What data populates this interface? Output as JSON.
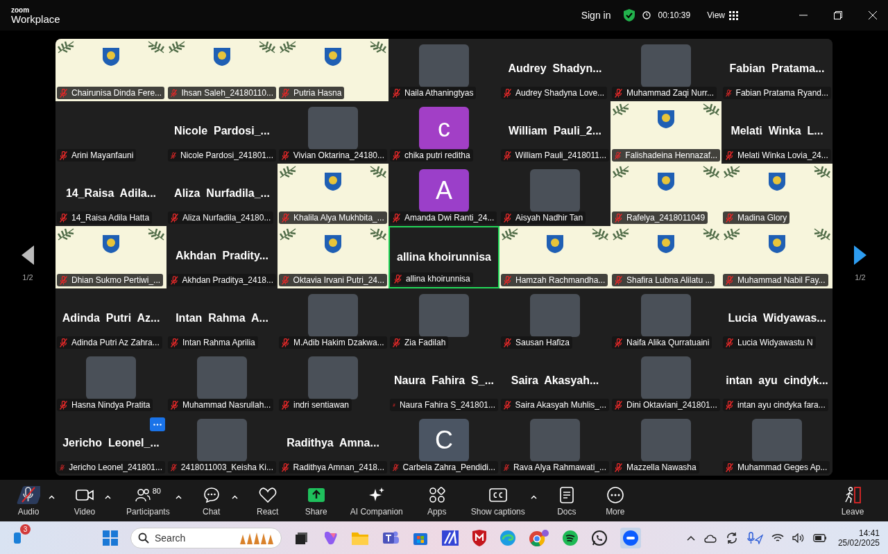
{
  "window": {
    "app_name": "zoom",
    "app_subtitle": "Workplace",
    "sign_in": "Sign in",
    "timer": "00:10:39",
    "view_label": "View"
  },
  "pager": {
    "left": "1/2",
    "right": "1/2"
  },
  "tiles": [
    {
      "kind": "video",
      "name": "Chairunisa Dinda Fere...",
      "muted": true,
      "speaking": false
    },
    {
      "kind": "video",
      "name": "Ihsan Saleh_24180110...",
      "muted": true,
      "speaking": false
    },
    {
      "kind": "video",
      "name": "Putria Hasna",
      "muted": true,
      "speaking": false
    },
    {
      "kind": "photo",
      "name": "Naila Athaningtyas",
      "muted": true,
      "speaking": false
    },
    {
      "kind": "name",
      "heading": "Audrey  Shadyn...",
      "name": "Audrey Shadyna Love...",
      "muted": true,
      "speaking": false
    },
    {
      "kind": "photo",
      "name": "Muhammad Zaqi Nurr...",
      "muted": true,
      "speaking": false
    },
    {
      "kind": "name",
      "heading": "Fabian  Pratama...",
      "name": "Fabian Pratama Ryand...",
      "muted": true,
      "speaking": false
    },
    {
      "kind": "blank",
      "name": "Arini Mayanfauni",
      "muted": true,
      "speaking": false
    },
    {
      "kind": "name",
      "heading": "Nicole  Pardosi_...",
      "name": "Nicole Pardosi_241801...",
      "muted": true,
      "speaking": false
    },
    {
      "kind": "photo",
      "name": "Vivian Oktarina_24180...",
      "muted": true,
      "speaking": false
    },
    {
      "kind": "letter",
      "letter": "c",
      "color": "#a23fc6",
      "name": "chika putri reditha",
      "muted": true,
      "speaking": false
    },
    {
      "kind": "name",
      "heading": "William  Pauli_2...",
      "name": "William Pauli_2418011...",
      "muted": true,
      "speaking": false
    },
    {
      "kind": "video",
      "name": "Falishadeina Hennazaf...",
      "muted": true,
      "speaking": false
    },
    {
      "kind": "name",
      "heading": "Melati  Winka  L...",
      "name": "Melati Winka Lovia_24...",
      "muted": true,
      "speaking": false
    },
    {
      "kind": "name",
      "heading": "14_Raisa  Adila...",
      "name": "14_Raisa Adila Hatta",
      "muted": true,
      "speaking": false
    },
    {
      "kind": "name",
      "heading": "Aliza  Nurfadila_...",
      "name": "Aliza Nurfadila_24180...",
      "muted": true,
      "speaking": false
    },
    {
      "kind": "video",
      "name": "Khalila Alya Mukhbita_...",
      "muted": true,
      "speaking": false
    },
    {
      "kind": "letter",
      "letter": "A",
      "color": "#9b3fc9",
      "name": "Amanda Dwi Ranti_24...",
      "muted": true,
      "speaking": false
    },
    {
      "kind": "photo",
      "name": "Aisyah Nadhir Tan",
      "muted": true,
      "speaking": false
    },
    {
      "kind": "video",
      "name": "Rafelya_2418011049",
      "muted": true,
      "speaking": false
    },
    {
      "kind": "video",
      "name": "Madina Glory",
      "muted": true,
      "speaking": false
    },
    {
      "kind": "video",
      "name": "Dhian Sukmo Pertiwi_...",
      "muted": true,
      "speaking": false
    },
    {
      "kind": "name",
      "heading": "Akhdan  Pradity...",
      "name": "Akhdan Praditya_2418...",
      "muted": true,
      "speaking": false
    },
    {
      "kind": "video",
      "name": "Oktavia Irvani Putri_24...",
      "muted": true,
      "speaking": false
    },
    {
      "kind": "name",
      "heading": "allina khoirunnisa",
      "name": "allina khoirunnisa",
      "muted": true,
      "speaking": true
    },
    {
      "kind": "video",
      "name": "Hamzah Rachmandha...",
      "muted": true,
      "speaking": false
    },
    {
      "kind": "video",
      "name": "Shafira Lubna Alilatu ...",
      "muted": true,
      "speaking": false
    },
    {
      "kind": "video",
      "name": "Muhammad Nabil Fay...",
      "muted": true,
      "speaking": false
    },
    {
      "kind": "name",
      "heading": "Adinda  Putri  Az...",
      "name": "Adinda Putri Az Zahra...",
      "muted": true,
      "speaking": false
    },
    {
      "kind": "name",
      "heading": "Intan  Rahma  A...",
      "name": "Intan Rahma Aprilia",
      "muted": true,
      "speaking": false
    },
    {
      "kind": "photo",
      "name": "M.Adib Hakim Dzakwa...",
      "muted": true,
      "speaking": false
    },
    {
      "kind": "photo",
      "name": "Zia Fadilah",
      "muted": true,
      "speaking": false
    },
    {
      "kind": "photo",
      "name": "Sausan Hafiza",
      "muted": true,
      "speaking": false
    },
    {
      "kind": "photo",
      "name": "Naifa Alika Qurratuaini",
      "muted": true,
      "speaking": false
    },
    {
      "kind": "name",
      "heading": "Lucia  Widyawas...",
      "name": "Lucia Widyawastu N",
      "muted": true,
      "speaking": false
    },
    {
      "kind": "photo",
      "name": "Hasna Nindya Pratita",
      "muted": true,
      "speaking": false
    },
    {
      "kind": "photo",
      "name": "Muhammad Nasrullah...",
      "muted": true,
      "speaking": false
    },
    {
      "kind": "photo",
      "name": "indri sentiawan",
      "muted": true,
      "speaking": false
    },
    {
      "kind": "name",
      "heading": "Naura  Fahira  S_...",
      "name": "Naura Fahira S_241801...",
      "muted": true,
      "speaking": false
    },
    {
      "kind": "name",
      "heading": "Saira  Akasyah...",
      "name": "Saira Akasyah Muhlis_...",
      "muted": true,
      "speaking": false
    },
    {
      "kind": "photo",
      "name": "Dini Oktaviani_241801...",
      "muted": true,
      "speaking": false
    },
    {
      "kind": "name",
      "heading": "intan  ayu  cindyk...",
      "name": "intan ayu cindyka fara...",
      "muted": true,
      "speaking": false
    },
    {
      "kind": "name",
      "heading": "Jericho  Leonel_...",
      "name": "Jericho Leonel_241801...",
      "muted": true,
      "speaking": false,
      "menu": true
    },
    {
      "kind": "photo",
      "name": "2418011003_Keisha Ki...",
      "muted": true,
      "speaking": false
    },
    {
      "kind": "name",
      "heading": "Radithya  Amna...",
      "name": "Radithya Amnan_2418...",
      "muted": true,
      "speaking": false
    },
    {
      "kind": "letter",
      "letter": "C",
      "color": "#4b5563",
      "name": "Carbela Zahra_Pendidi...",
      "muted": true,
      "speaking": false
    },
    {
      "kind": "photo",
      "name": "Rava Alya Rahmawati_...",
      "muted": true,
      "speaking": false
    },
    {
      "kind": "photo",
      "name": "Mazzella Nawasha",
      "muted": true,
      "speaking": false
    },
    {
      "kind": "photo",
      "name": "Muhammad Geges Ap...",
      "muted": true,
      "speaking": false
    }
  ],
  "toolbar": [
    {
      "kind": "audio",
      "label": "Audio",
      "caret": true
    },
    {
      "kind": "video",
      "label": "Video",
      "caret": true
    },
    {
      "kind": "participants",
      "label": "Participants",
      "count": "80",
      "caret": true
    },
    {
      "kind": "chat",
      "label": "Chat",
      "caret": true
    },
    {
      "kind": "react",
      "label": "React",
      "caret": false
    },
    {
      "kind": "share",
      "label": "Share",
      "caret": false
    },
    {
      "kind": "ai",
      "label": "AI Companion",
      "caret": false
    },
    {
      "kind": "apps",
      "label": "Apps",
      "caret": false
    },
    {
      "kind": "captions",
      "label": "Show captions",
      "caret": true
    },
    {
      "kind": "docs",
      "label": "Docs",
      "caret": false
    },
    {
      "kind": "more",
      "label": "More",
      "caret": false
    },
    {
      "kind": "leave",
      "label": "Leave",
      "caret": false
    }
  ],
  "taskbar": {
    "badge": "3",
    "search_placeholder": "Search",
    "time": "14:41",
    "date": "25/02/2025"
  }
}
